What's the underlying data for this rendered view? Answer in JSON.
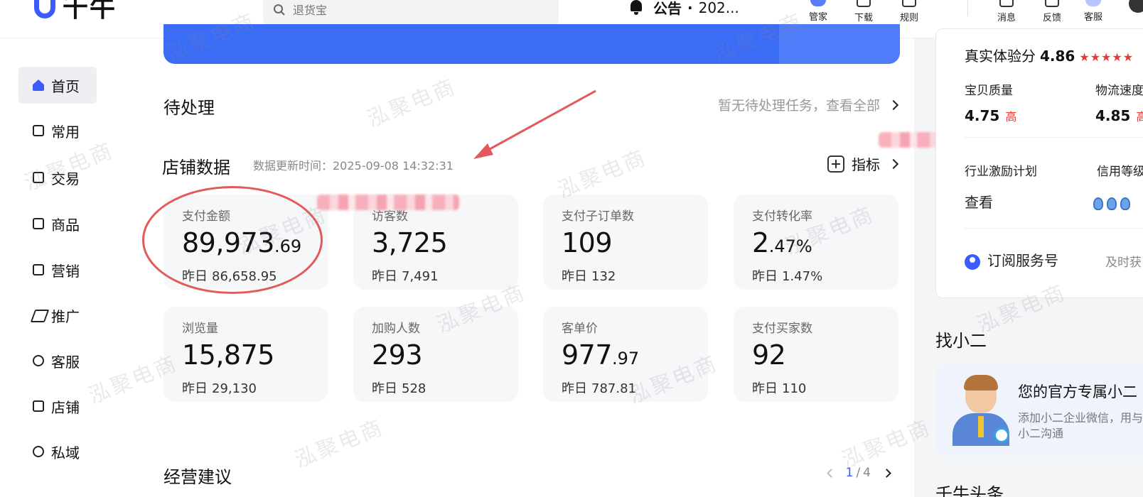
{
  "app": {
    "logo_text": "千牛"
  },
  "search": {
    "placeholder": "退货宝"
  },
  "notice": {
    "label": "公告",
    "separator": "·",
    "date": "202..."
  },
  "toolbar": {
    "items": [
      {
        "label": "管家",
        "icon": "butler-icon"
      },
      {
        "label": "下载",
        "icon": "download-icon"
      },
      {
        "label": "规则",
        "icon": "rules-icon"
      },
      {
        "label": "消息",
        "icon": "message-icon"
      },
      {
        "label": "反馈",
        "icon": "feedback-icon"
      },
      {
        "label": "客服",
        "icon": "customer-service-icon"
      }
    ]
  },
  "sidebar": {
    "items": [
      {
        "label": "首页",
        "icon": "home-icon",
        "active": true
      },
      {
        "label": "常用",
        "icon": "favorites-icon"
      },
      {
        "label": "交易",
        "icon": "trade-icon"
      },
      {
        "label": "商品",
        "icon": "goods-icon"
      },
      {
        "label": "营销",
        "icon": "marketing-icon"
      },
      {
        "label": "推广",
        "icon": "promotion-icon"
      },
      {
        "label": "客服",
        "icon": "service-icon"
      },
      {
        "label": "店铺",
        "icon": "shop-icon"
      },
      {
        "label": "私域",
        "icon": "private-domain-icon"
      }
    ]
  },
  "pending": {
    "title": "待处理",
    "link": "暂无待处理任务，查看全部"
  },
  "store_data": {
    "title": "店铺数据",
    "update_time": "数据更新时间：2025-09-08 14:32:31",
    "metric_link": "指标",
    "yesterday_label": "昨日",
    "cards": [
      {
        "label": "支付金额",
        "value_int": "89,973",
        "value_dec": ".69",
        "yesterday": "86,658.95"
      },
      {
        "label": "访客数",
        "value_int": "3,725",
        "value_dec": "",
        "yesterday": "7,491"
      },
      {
        "label": "支付子订单数",
        "value_int": "109",
        "value_dec": "",
        "yesterday": "132"
      },
      {
        "label": "支付转化率",
        "value_int": "2",
        "value_dec": ".47%",
        "yesterday": "1.47%"
      },
      {
        "label": "浏览量",
        "value_int": "15,875",
        "value_dec": "",
        "yesterday": "29,130"
      },
      {
        "label": "加购人数",
        "value_int": "293",
        "value_dec": "",
        "yesterday": "528"
      },
      {
        "label": "客单价",
        "value_int": "977",
        "value_dec": ".97",
        "yesterday": "787.81"
      },
      {
        "label": "支付买家数",
        "value_int": "92",
        "value_dec": "",
        "yesterday": "110"
      }
    ]
  },
  "advice": {
    "title": "经营建议",
    "page_current": "1",
    "page_sep": "/",
    "page_total": "4"
  },
  "right_panel": {
    "score_label": "真实体验分",
    "score_value": "4.86",
    "stars": "★★★★★",
    "quality_label": "宝贝质量",
    "quality_value": "4.75",
    "quality_level": "高",
    "logistics_label": "物流速度",
    "logistics_value": "4.85",
    "logistics_level": "高",
    "incentive_label": "行业激励计划",
    "incentive_action": "查看",
    "credit_label": "信用等级",
    "subscribe_label": "订阅服务号",
    "subscribe_hint": "及时获"
  },
  "helper": {
    "title": "找小二",
    "name": "您的官方专属小二",
    "desc": "添加小二企业微信，用与小二沟通"
  },
  "bottom_right": {
    "title": "千牛头条"
  },
  "watermark": "泓聚电商",
  "colors": {
    "accent": "#3b5bfd",
    "banner": "#3b6cf6",
    "annotation_red": "#e25a5a",
    "star_red": "#e63a3a"
  }
}
